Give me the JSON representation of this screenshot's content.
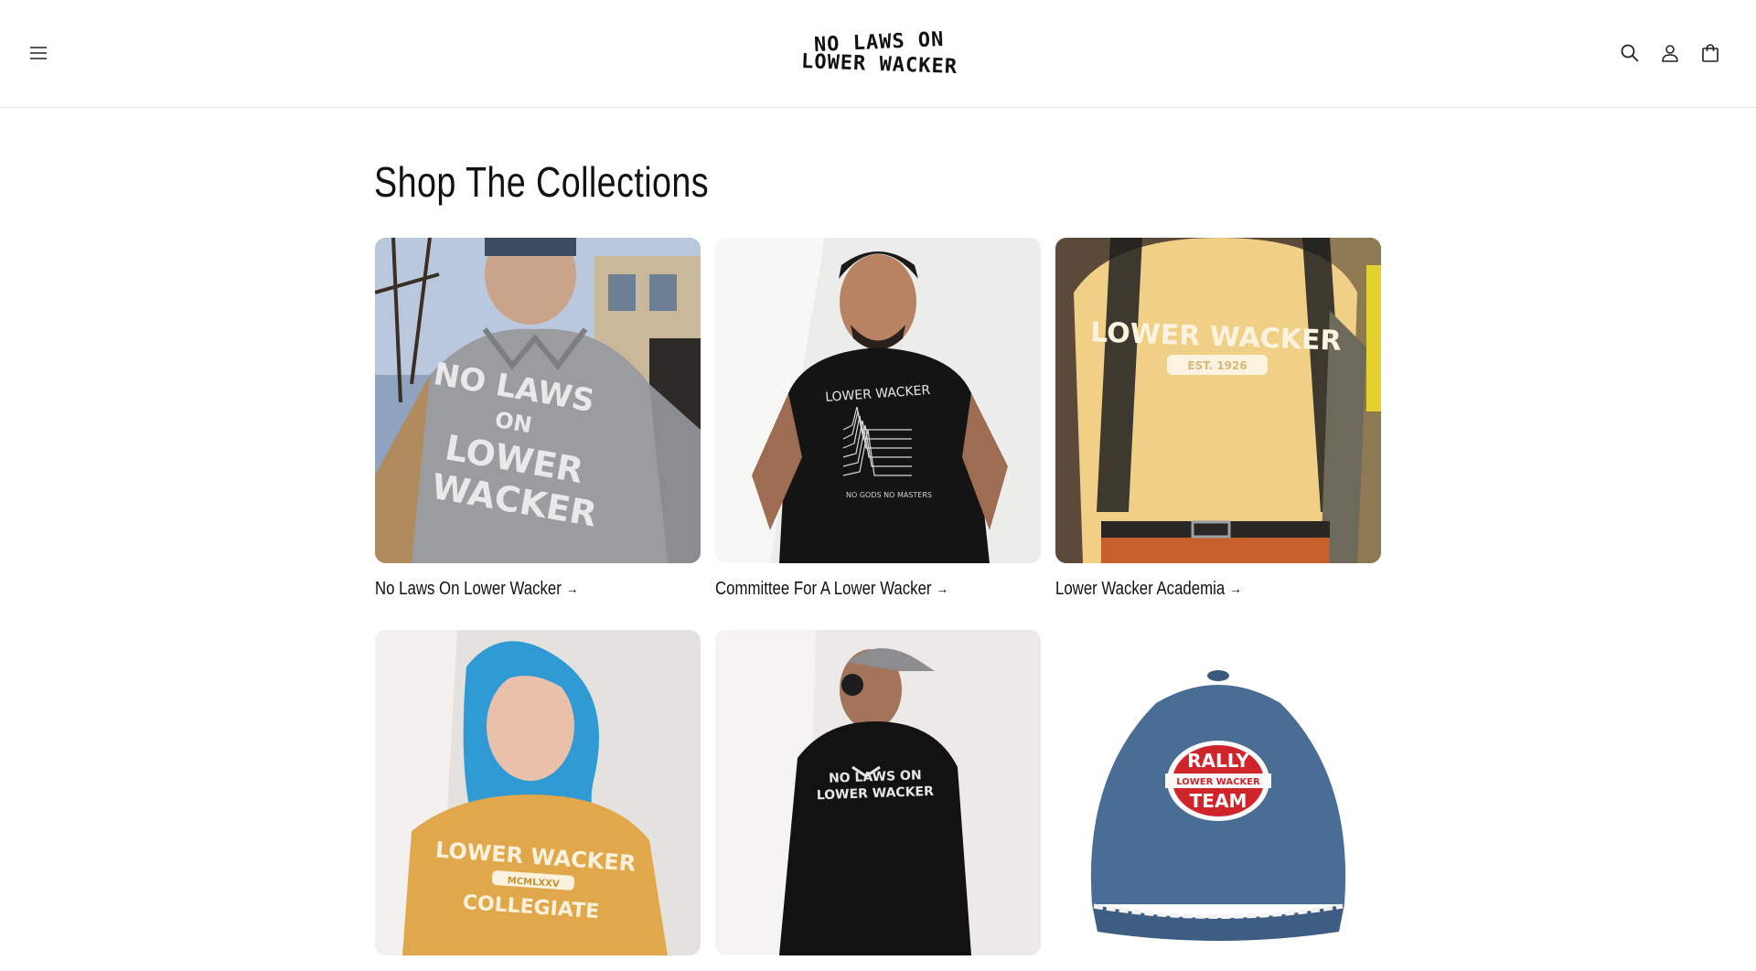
{
  "header": {
    "logo_line1": "NO LAWS ON",
    "logo_line2": "LOWER WACKER",
    "icons": [
      "menu-icon",
      "search-icon",
      "account-icon",
      "cart-icon"
    ]
  },
  "main": {
    "title": "Shop The Collections",
    "collections": [
      {
        "label": "No Laws On Lower Wacker",
        "arrow": "→",
        "print": [
          "NO LAWS",
          "ON",
          "LOWER",
          "WACKER"
        ]
      },
      {
        "label": "Committee For A Lower Wacker",
        "arrow": "→",
        "print": [
          "LOWER WACKER",
          "NO GODS NO MASTERS"
        ]
      },
      {
        "label": "Lower Wacker Academia",
        "arrow": "→",
        "print": [
          "LOWER WACKER",
          "EST. 1926"
        ]
      },
      {
        "label": "",
        "print": [
          "LOWER WACKER",
          "MCMLXXV",
          "COLLEGIATE"
        ]
      },
      {
        "label": "",
        "print": [
          "NO LAWS ON",
          "LOWER WACKER"
        ]
      },
      {
        "label": "",
        "print": [
          "RALLY",
          "LOWER WACKER",
          "TEAM"
        ]
      }
    ]
  },
  "colors": {
    "text": "#121212",
    "border": "#e6e6e6",
    "background": "#ffffff"
  }
}
